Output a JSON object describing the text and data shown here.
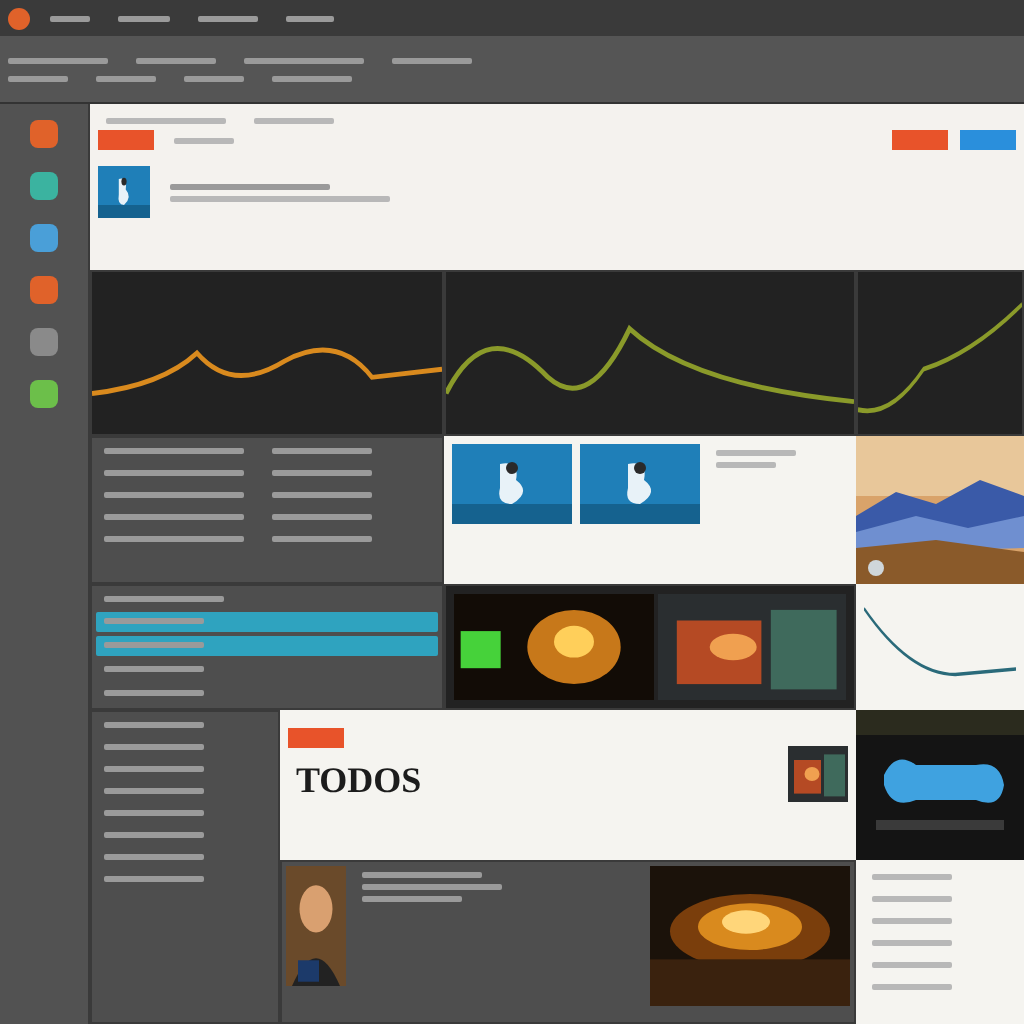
{
  "sidebar": {
    "items": [
      {
        "color": "#e0622a"
      },
      {
        "color": "#3bb3a0"
      },
      {
        "color": "#4a9fd8"
      },
      {
        "color": "#e0622a"
      },
      {
        "color": "#8a8a8a"
      },
      {
        "color": "#6cbf4a"
      }
    ]
  },
  "track_list": {
    "rows": [
      {
        "selected": true
      },
      {
        "selected": true
      },
      {
        "selected": false
      },
      {
        "selected": false
      }
    ]
  },
  "feature": {
    "title": "TODOS"
  }
}
